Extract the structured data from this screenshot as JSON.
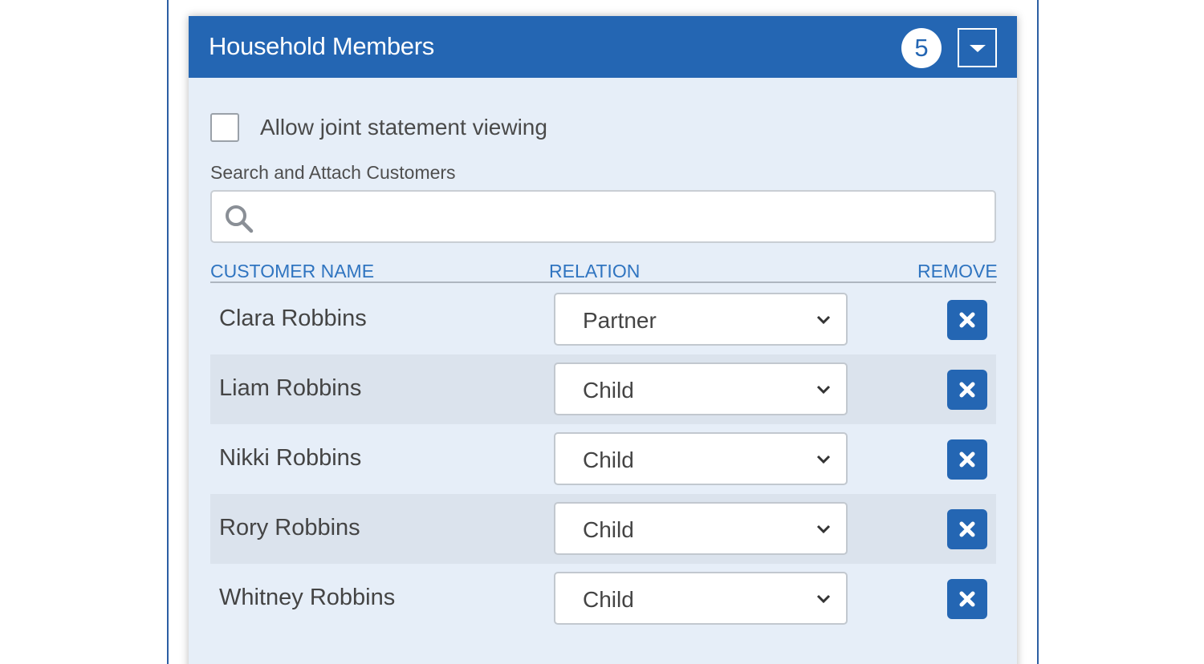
{
  "panel": {
    "title": "Household Members",
    "count": "5",
    "collapse_icon": "caret-down-icon"
  },
  "options": {
    "joint_statement_label": "Allow joint statement viewing",
    "joint_statement_checked": false
  },
  "search": {
    "label": "Search and Attach Customers",
    "value": "",
    "placeholder": "",
    "icon": "search-icon"
  },
  "table": {
    "headers": {
      "name": "CUSTOMER NAME",
      "relation": "RELATION",
      "remove": "REMOVE"
    },
    "rows": [
      {
        "name": "Clara Robbins",
        "relation": "Partner"
      },
      {
        "name": "Liam Robbins",
        "relation": "Child"
      },
      {
        "name": "Nikki Robbins",
        "relation": "Child"
      },
      {
        "name": "Rory Robbins",
        "relation": "Child"
      },
      {
        "name": "Whitney Robbins",
        "relation": "Child"
      }
    ]
  },
  "colors": {
    "header_blue": "#2466b3",
    "panel_bg": "#e6eef8",
    "alt_row_bg": "#dbe3ed",
    "column_header_text": "#2f74c0"
  }
}
